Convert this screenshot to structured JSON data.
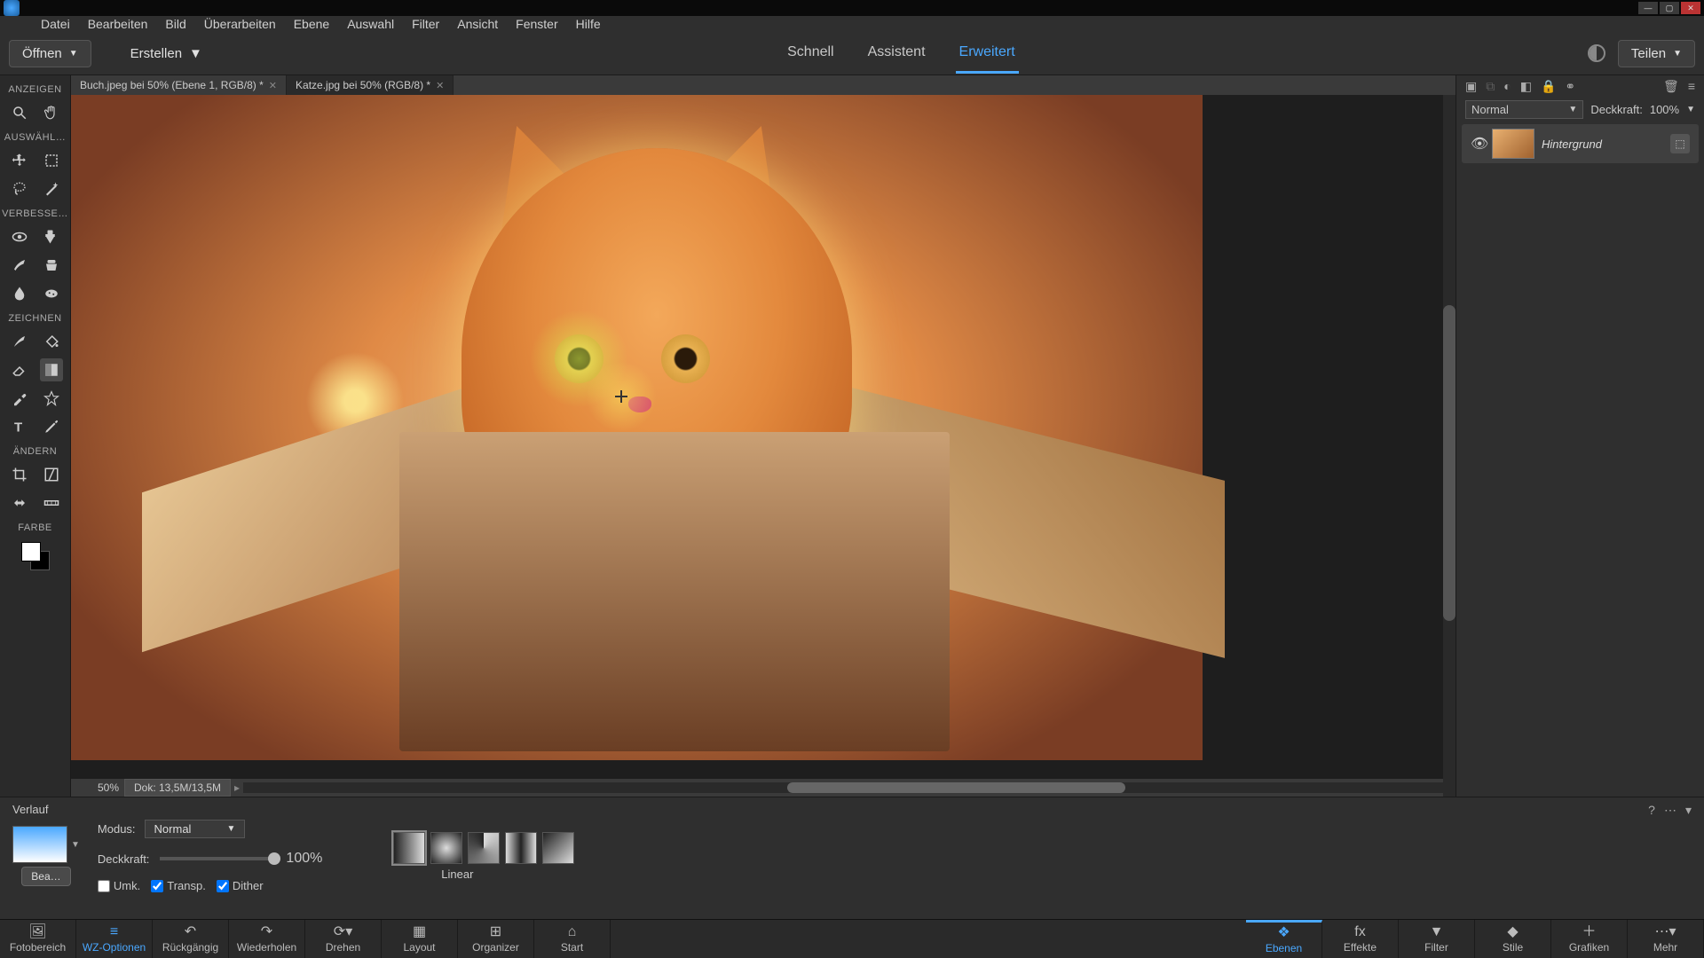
{
  "menu": {
    "items": [
      "Datei",
      "Bearbeiten",
      "Bild",
      "Überarbeiten",
      "Ebene",
      "Auswahl",
      "Filter",
      "Ansicht",
      "Fenster",
      "Hilfe"
    ]
  },
  "header": {
    "open": "Öffnen",
    "create": "Erstellen",
    "modes": {
      "quick": "Schnell",
      "assistant": "Assistent",
      "expert": "Erweitert"
    },
    "share": "Teilen"
  },
  "doctabs": {
    "tab1": "Buch.jpeg bei 50% (Ebene 1, RGB/8) *",
    "tab2": "Katze.jpg bei 50% (RGB/8) *"
  },
  "status": {
    "zoom": "50%",
    "dok": "Dok: 13,5M/13,5M"
  },
  "tools": {
    "headers": {
      "view": "ANZEIGEN",
      "select": "AUSWÄHL…",
      "enhance": "VERBESSE…",
      "draw": "ZEICHNEN",
      "modify": "ÄNDERN",
      "color": "FARBE"
    }
  },
  "layers": {
    "blend_label": "Normal",
    "opacity_label": "Deckkraft:",
    "opacity_value": "100%",
    "layer_name": "Hintergrund"
  },
  "options": {
    "title": "Verlauf",
    "mode_label": "Modus:",
    "mode_value": "Normal",
    "opacity_label": "Deckkraft:",
    "opacity_value": "100%",
    "type_label": "Linear",
    "edit": "Bea…",
    "reverse": "Umk.",
    "transparency": "Transp.",
    "dither": "Dither"
  },
  "bottombar": {
    "left": {
      "photobin": "Fotobereich",
      "toolopts": "WZ-Optionen",
      "undo": "Rückgängig",
      "redo": "Wiederholen",
      "rotate": "Drehen",
      "layout": "Layout",
      "organizer": "Organizer",
      "home": "Start"
    },
    "right": {
      "layers": "Ebenen",
      "effects": "Effekte",
      "filter": "Filter",
      "styles": "Stile",
      "graphics": "Grafiken",
      "more": "Mehr"
    }
  }
}
